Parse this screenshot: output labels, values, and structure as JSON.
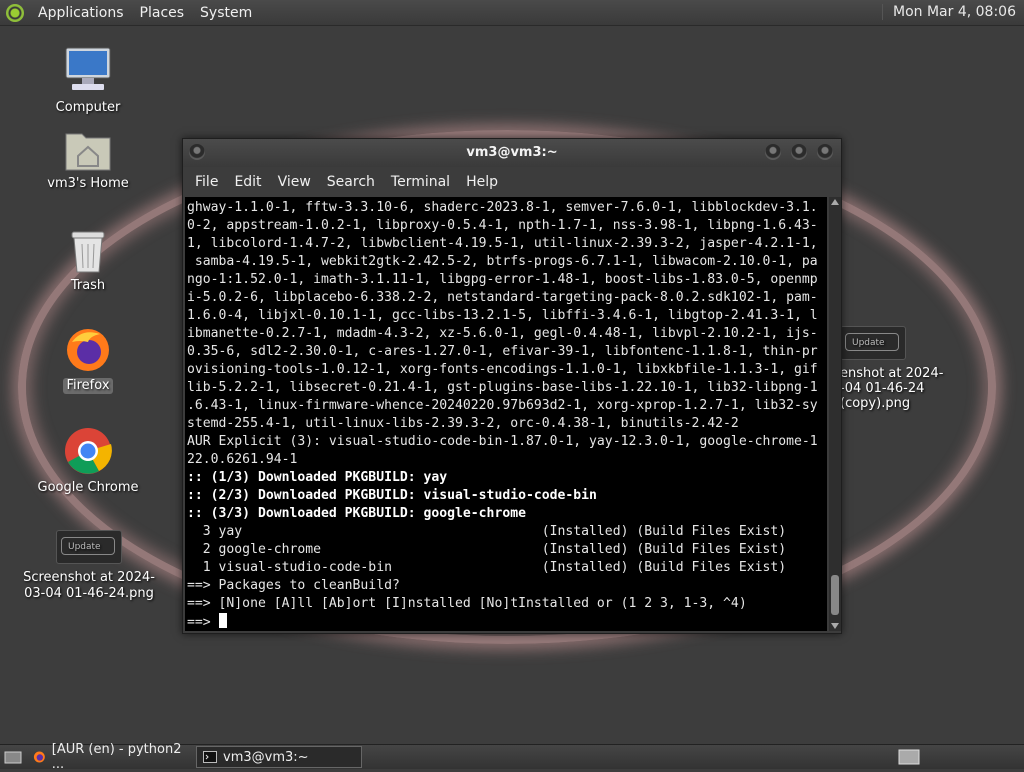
{
  "top_panel": {
    "menus": [
      "Applications",
      "Places",
      "System"
    ],
    "clock": "Mon Mar  4, 08:06"
  },
  "desktop_icons": [
    {
      "label": "Computer",
      "icon": "computer-icon"
    },
    {
      "label": "vm3's Home",
      "icon": "home-folder-icon"
    },
    {
      "label": "Trash",
      "icon": "trash-icon"
    },
    {
      "label": "Firefox",
      "icon": "firefox-icon"
    },
    {
      "label": "Google Chrome",
      "icon": "chrome-icon"
    },
    {
      "label": "Screenshot at 2024-03-04 01-46-24.png",
      "icon": "image-thumbnail-icon",
      "thumb_button": "Update"
    }
  ],
  "right_file": {
    "thumb_button": "Update",
    "label_line1": "enshot at 2024-",
    "label_line2": "-04 01-46-24",
    "label_line3": "(copy).png"
  },
  "terminal": {
    "title": "vm3@vm3:~",
    "menu": [
      "File",
      "Edit",
      "View",
      "Search",
      "Terminal",
      "Help"
    ],
    "lines": [
      {
        "t": "ghway-1.1.0-1, fftw-3.3.10-6, shaderc-2023.8-1, semver-7.6.0-1, libblockdev-3.1."
      },
      {
        "t": "0-2, appstream-1.0.2-1, libproxy-0.5.4-1, npth-1.7-1, nss-3.98-1, libpng-1.6.43-"
      },
      {
        "t": "1, libcolord-1.4.7-2, libwbclient-4.19.5-1, util-linux-2.39.3-2, jasper-4.2.1-1,"
      },
      {
        "t": " samba-4.19.5-1, webkit2gtk-2.42.5-2, btrfs-progs-6.7.1-1, libwacom-2.10.0-1, pa"
      },
      {
        "t": "ngo-1:1.52.0-1, imath-3.1.11-1, libgpg-error-1.48-1, boost-libs-1.83.0-5, openmp"
      },
      {
        "t": "i-5.0.2-6, libplacebo-6.338.2-2, netstandard-targeting-pack-8.0.2.sdk102-1, pam-"
      },
      {
        "t": "1.6.0-4, libjxl-0.10.1-1, gcc-libs-13.2.1-5, libffi-3.4.6-1, libgtop-2.41.3-1, l"
      },
      {
        "t": "ibmanette-0.2.7-1, mdadm-4.3-2, xz-5.6.0-1, gegl-0.4.48-1, libvpl-2.10.2-1, ijs-"
      },
      {
        "t": "0.35-6, sdl2-2.30.0-1, c-ares-1.27.0-1, efivar-39-1, libfontenc-1.1.8-1, thin-pr"
      },
      {
        "t": "ovisioning-tools-1.0.12-1, xorg-fonts-encodings-1.1.0-1, libxkbfile-1.1.3-1, gif"
      },
      {
        "t": "lib-5.2.2-1, libsecret-0.21.4-1, gst-plugins-base-libs-1.22.10-1, lib32-libpng-1"
      },
      {
        "t": ".6.43-1, linux-firmware-whence-20240220.97b693d2-1, xorg-xprop-1.2.7-1, lib32-sy"
      },
      {
        "t": "stemd-255.4-1, util-linux-libs-2.39.3-2, orc-0.4.38-1, binutils-2.42-2"
      },
      {
        "t": "AUR Explicit (3): visual-studio-code-bin-1.87.0-1, yay-12.3.0-1, google-chrome-1"
      },
      {
        "t": "22.0.6261.94-1"
      },
      {
        "t": ":: (1/3) Downloaded PKGBUILD: yay",
        "bold": true
      },
      {
        "t": ":: (2/3) Downloaded PKGBUILD: visual-studio-code-bin",
        "bold": true
      },
      {
        "t": ":: (3/3) Downloaded PKGBUILD: google-chrome",
        "bold": true
      },
      {
        "t": "  3 yay                                      (Installed) (Build Files Exist)"
      },
      {
        "t": "  2 google-chrome                            (Installed) (Build Files Exist)"
      },
      {
        "t": "  1 visual-studio-code-bin                   (Installed) (Build Files Exist)"
      },
      {
        "t": "==> Packages to cleanBuild?"
      },
      {
        "t": "==> [N]one [A]ll [Ab]ort [I]nstalled [No]tInstalled or (1 2 3, 1-3, ^4)"
      },
      {
        "t": "==> ",
        "cursor": true
      }
    ]
  },
  "taskbar": {
    "tasks": [
      {
        "label": "[AUR (en) - python2 ...",
        "icon": "firefox-icon"
      },
      {
        "label": "vm3@vm3:~",
        "icon": "terminal-icon",
        "active": true
      }
    ]
  }
}
